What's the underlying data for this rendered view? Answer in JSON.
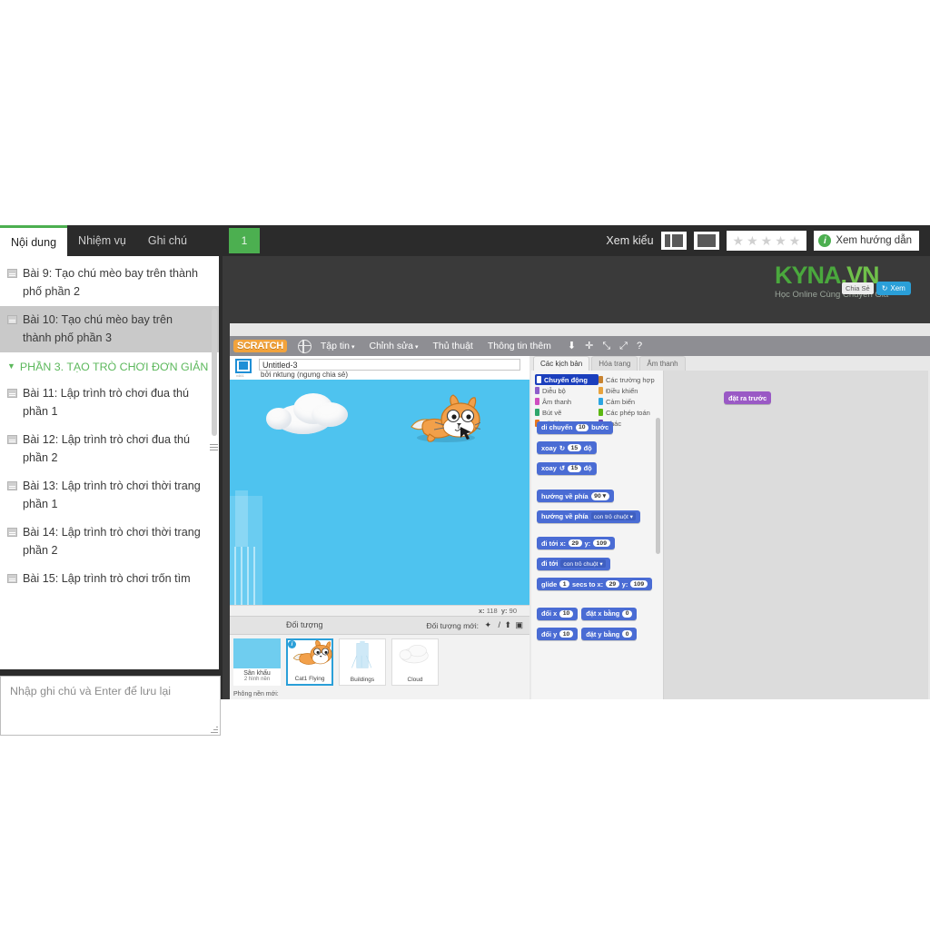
{
  "player": {
    "tabs": [
      {
        "label": "Nội dung",
        "active": true
      },
      {
        "label": "Nhiệm vụ",
        "active": false
      },
      {
        "label": "Ghi chú",
        "active": false
      }
    ],
    "lesson_badge": "1",
    "view_label": "Xem kiểu",
    "guide_label": "Xem hướng dẫn",
    "stars": [
      "★",
      "★",
      "★",
      "★",
      "★"
    ]
  },
  "sidebar": {
    "items": [
      {
        "label": "Bài 9: Tạo chú mèo bay trên thành phố phần 2",
        "selected": false
      },
      {
        "label": "Bài 10: Tạo chú mèo bay trên thành phố phần 3",
        "selected": true
      }
    ],
    "section_title": "PHẦN 3. TẠO TRÒ CHƠI ĐƠN GIẢN",
    "section_items": [
      {
        "label": "Bài 11: Lập trình trò chơi đua thú phần 1"
      },
      {
        "label": "Bài 12: Lập trình trò chơi đua thú phần 2"
      },
      {
        "label": "Bài 13: Lập trình trò chơi thời trang phần 1"
      },
      {
        "label": "Bài 14: Lập trình trò chơi thời trang phần 2"
      },
      {
        "label": "Bài 15: Lập trình trò chơi trốn tìm"
      }
    ],
    "note_placeholder": "Nhập ghi chú và Enter để lưu lại"
  },
  "scratch": {
    "logo": "SCRATCH",
    "menus": [
      {
        "label": "Tập tin",
        "caret": "▾"
      },
      {
        "label": "Chỉnh sửa",
        "caret": "▾"
      },
      {
        "label": "Thủ thuật",
        "caret": ""
      },
      {
        "label": "Thông tin thêm",
        "caret": ""
      }
    ],
    "tool_icons": [
      "⬇",
      "✛",
      "⤡",
      "⤢",
      "?"
    ],
    "project_title": "Untitled-3",
    "byline": "bởi nktung (ngưng chia sẻ)",
    "version_tag": "v461",
    "flag": "⚑",
    "coords": {
      "x_label": "x:",
      "x_value": "118",
      "y_label": "y:",
      "y_value": "90"
    },
    "tabs": [
      {
        "label": "Các kịch bản",
        "active": true
      },
      {
        "label": "Hóa trang",
        "active": false
      },
      {
        "label": "Âm thanh",
        "active": false
      }
    ],
    "categories": [
      {
        "label": "Chuyển động",
        "color": "#4a6cd4",
        "active": true
      },
      {
        "label": "Các trường hợp",
        "color": "#c88330",
        "active": false
      },
      {
        "label": "Diễu bộ",
        "color": "#8e5ecb",
        "active": false
      },
      {
        "label": "Điều khiển",
        "color": "#e8a33d",
        "active": false
      },
      {
        "label": "Âm thanh",
        "color": "#cf4ec0",
        "active": false
      },
      {
        "label": "Cảm biến",
        "color": "#2ca5e2",
        "active": false
      },
      {
        "label": "Bút vẽ",
        "color": "#2fa66b",
        "active": false
      },
      {
        "label": "Các phép toán",
        "color": "#5cb712",
        "active": false
      },
      {
        "label": "Dữ liệu",
        "color": "#e8761d",
        "active": false
      },
      {
        "label": "Khác",
        "color": "#6b4bb5",
        "active": false
      }
    ],
    "blocks_group1": [
      {
        "parts": [
          {
            "t": "text",
            "v": "di chuyển"
          },
          {
            "t": "oval",
            "v": "10"
          },
          {
            "t": "text",
            "v": "bước"
          }
        ]
      },
      {
        "parts": [
          {
            "t": "text",
            "v": "xoay"
          },
          {
            "t": "text",
            "v": "↻"
          },
          {
            "t": "oval",
            "v": "15"
          },
          {
            "t": "text",
            "v": "độ"
          }
        ]
      },
      {
        "parts": [
          {
            "t": "text",
            "v": "xoay"
          },
          {
            "t": "text",
            "v": "↺"
          },
          {
            "t": "oval",
            "v": "15"
          },
          {
            "t": "text",
            "v": "độ"
          }
        ]
      }
    ],
    "blocks_group2": [
      {
        "parts": [
          {
            "t": "text",
            "v": "hướng về phía"
          },
          {
            "t": "oval",
            "v": "90 ▾"
          }
        ]
      },
      {
        "parts": [
          {
            "t": "text",
            "v": "hướng về phía"
          },
          {
            "t": "drop",
            "v": "con trỏ chuột ▾"
          }
        ]
      }
    ],
    "blocks_group3": [
      {
        "parts": [
          {
            "t": "text",
            "v": "đi tới x:"
          },
          {
            "t": "oval",
            "v": "29"
          },
          {
            "t": "text",
            "v": "y:"
          },
          {
            "t": "oval",
            "v": "109"
          }
        ]
      },
      {
        "parts": [
          {
            "t": "text",
            "v": "đi tới"
          },
          {
            "t": "drop",
            "v": "con trỏ chuột ▾"
          }
        ]
      },
      {
        "parts": [
          {
            "t": "text",
            "v": "glide"
          },
          {
            "t": "oval",
            "v": "1"
          },
          {
            "t": "text",
            "v": "secs to x:"
          },
          {
            "t": "oval",
            "v": "29"
          },
          {
            "t": "text",
            "v": "y:"
          },
          {
            "t": "oval",
            "v": "109"
          }
        ]
      }
    ],
    "blocks_group4": [
      {
        "parts": [
          {
            "t": "text",
            "v": "đổi x"
          },
          {
            "t": "oval",
            "v": "10"
          }
        ]
      },
      {
        "parts": [
          {
            "t": "text",
            "v": "đặt x bằng"
          },
          {
            "t": "oval",
            "v": "0"
          }
        ]
      },
      {
        "parts": [
          {
            "t": "text",
            "v": "đổi y"
          },
          {
            "t": "oval",
            "v": "10"
          }
        ]
      },
      {
        "parts": [
          {
            "t": "text",
            "v": "đặt y bằng"
          },
          {
            "t": "oval",
            "v": "0"
          }
        ]
      }
    ],
    "script_block": "đặt ra trước",
    "sprite_pane": {
      "title": "Đối tượng",
      "new_label": "Đối tượng mới:",
      "new_icons": [
        "✦",
        "/",
        "⬆",
        "▣"
      ],
      "stage": {
        "name": "Sân khấu",
        "sub": "2 hình nền"
      },
      "sprites": [
        {
          "name": "Cat1 Flying",
          "selected": true,
          "info": "i"
        },
        {
          "name": "Buildings",
          "selected": false,
          "info": ""
        },
        {
          "name": "Cloud",
          "selected": false,
          "info": ""
        }
      ],
      "new_bg_label": "Phông nền mới:",
      "new_bg_icons": [
        "▣",
        "/",
        "⬆",
        "▣"
      ]
    }
  },
  "watermark": {
    "brand_a": "KYNA",
    "brand_b": ".VN",
    "tagline": "Học Online Cùng Chuyên Gia",
    "share_label": "Chia Sẻ",
    "share_button": "Xem",
    "share_icon": "↻"
  }
}
